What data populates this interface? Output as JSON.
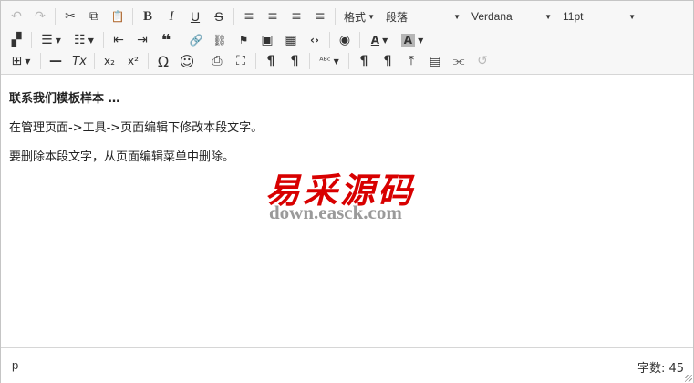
{
  "toolbar": {
    "undo": "↶",
    "redo": "↷",
    "cut": "✂",
    "copy": "⧉",
    "paste": "📋",
    "bold": "B",
    "italic": "I",
    "underline": "U",
    "strike": "S",
    "align_left": "≡",
    "align_center": "≡",
    "align_right": "≡",
    "justify": "≡",
    "formats_label": "格式",
    "block_label": "段落",
    "font_label": "Verdana",
    "size_label": "11pt",
    "find": "▞",
    "bullet_list": "☰",
    "num_list": "☷",
    "outdent": "⇤",
    "indent": "⇥",
    "blockquote": "❝",
    "link": "🔗",
    "unlink": "⛓",
    "anchor": "⚑",
    "image": "▣",
    "media": "▦",
    "code": "‹›",
    "preview": "◉",
    "text_color": "A",
    "bg_color": "A",
    "table": "⊞",
    "hr": "—",
    "clear_format": "Tx",
    "subscript": "x₂",
    "superscript": "x²",
    "charmap": "Ω",
    "emoticons": "☺",
    "print": "⎙",
    "fullscreen": "⛶",
    "ltr": "¶",
    "rtl": "¶",
    "spellcheck": "ᴬᴮᶜ",
    "pilcrow1": "¶",
    "pilcrow2": "¶",
    "upload": "⤒",
    "visualblocks": "▤",
    "pagebreak": "⫘",
    "restore": "↺"
  },
  "content": {
    "heading": "联系我们模板样本 …",
    "paragraph1": "在管理页面->工具->页面编辑下修改本段文字。",
    "paragraph2": "要删除本段文字，从页面编辑菜单中删除。"
  },
  "watermark": {
    "title": "易采源码",
    "url": "down.easck.com"
  },
  "status": {
    "path": "p",
    "word_count": "字数: 45"
  }
}
